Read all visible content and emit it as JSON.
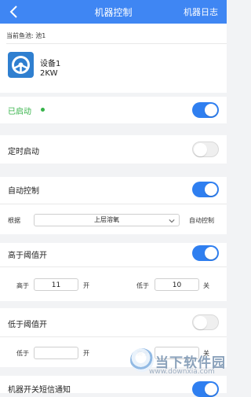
{
  "header": {
    "title": "机器控制",
    "right_label": "机器日志"
  },
  "pond": {
    "label": "当前鱼池: 池1"
  },
  "device": {
    "name": "设备1",
    "power": "2KW"
  },
  "status": {
    "label": "已启动",
    "enabled": true
  },
  "timer": {
    "label": "定时启动",
    "enabled": false
  },
  "auto": {
    "label": "自动控制",
    "enabled": true,
    "basis_label": "根据",
    "select_value": "上层溶氧",
    "right_label": "自动控制"
  },
  "high": {
    "label": "高于阈值开",
    "enabled": true,
    "above_label": "高于",
    "above_value": "11",
    "on_label": "开",
    "below_label": "低于",
    "below_value": "10",
    "off_label": "关"
  },
  "low": {
    "label": "低于阈值开",
    "enabled": false,
    "above_label": "低于",
    "above_value": "",
    "on_label": "开",
    "below_label": "高于",
    "below_value": "",
    "off_label": "关"
  },
  "notify": {
    "label": "机器开关短信通知",
    "enabled": true
  },
  "watermark": {
    "main": "当下软件园",
    "url": "www.downxia.com"
  },
  "colors": {
    "topbar": "#3f86f3",
    "accent": "#2f7ff0",
    "status": "#37b34a"
  },
  "icons": {
    "back": "chevron-left-icon",
    "device": "steering-wheel-icon",
    "select_arrow": "chevron-down-icon"
  }
}
